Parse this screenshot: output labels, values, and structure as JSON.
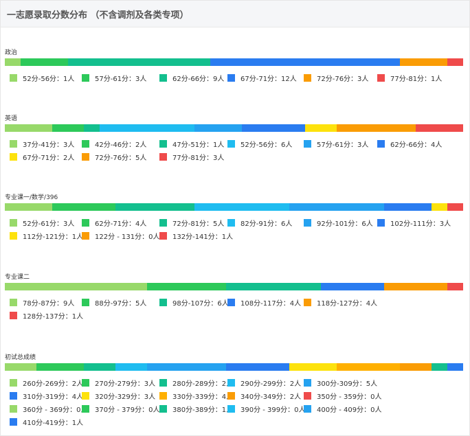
{
  "header": {
    "title": "一志愿录取分数分布 （不含调剂及各类专项）"
  },
  "palette": [
    "#98d96a",
    "#2dc95a",
    "#13bf8e",
    "#1fbcf0",
    "#25a2f0",
    "#2a7cf0",
    "#fde20d",
    "#ffb000",
    "#fa9c05",
    "#ef4b4b"
  ],
  "chart_data": [
    {
      "type": "stacked-bar",
      "title": "政治",
      "unit": "人",
      "categories": [
        "52分-56分",
        "57分-61分",
        "62分-66分",
        "67分-71分",
        "72分-76分",
        "77分-81分"
      ],
      "values": [
        1,
        3,
        9,
        12,
        3,
        1
      ],
      "colors": [
        "#98d96a",
        "#2dc95a",
        "#13bf8e",
        "#2a7cf0",
        "#fa9c05",
        "#ef4b4b"
      ],
      "legend_rows": [
        [
          0,
          1,
          2,
          3,
          4,
          5
        ]
      ]
    },
    {
      "type": "stacked-bar",
      "title": "英语",
      "unit": "人",
      "categories": [
        "37分-41分",
        "42分-46分",
        "47分-51分",
        "52分-56分",
        "57分-61分",
        "62分-66分",
        "67分-71分",
        "72分-76分",
        "77分-81分"
      ],
      "values": [
        3,
        2,
        1,
        6,
        3,
        4,
        2,
        5,
        3
      ],
      "colors": [
        "#98d96a",
        "#2dc95a",
        "#13bf8e",
        "#1fbcf0",
        "#25a2f0",
        "#2a7cf0",
        "#fde20d",
        "#fa9c05",
        "#ef4b4b"
      ],
      "legend_rows": [
        [
          0,
          1,
          2,
          3,
          4,
          5
        ],
        [
          6,
          7,
          8
        ]
      ]
    },
    {
      "type": "stacked-bar",
      "title": "专业课一/数学/396",
      "unit": "人",
      "categories": [
        "52分-61分",
        "62分-71分",
        "72分-81分",
        "82分-91分",
        "92分-101分",
        "102分-111分",
        "112分-121分",
        "122分 - 131分",
        "132分-141分"
      ],
      "values": [
        3,
        4,
        5,
        6,
        6,
        3,
        1,
        0,
        1
      ],
      "colors": [
        "#98d96a",
        "#2dc95a",
        "#13bf8e",
        "#1fbcf0",
        "#25a2f0",
        "#2a7cf0",
        "#fde20d",
        "#fa9c05",
        "#ef4b4b"
      ],
      "legend_rows": [
        [
          0,
          1,
          2,
          3,
          4,
          5
        ],
        [
          6,
          7,
          8
        ]
      ]
    },
    {
      "type": "stacked-bar",
      "title": "专业课二",
      "unit": "人",
      "categories": [
        "78分-87分",
        "88分-97分",
        "98分-107分",
        "108分-117分",
        "118分-127分",
        "128分-137分"
      ],
      "values": [
        9,
        5,
        6,
        4,
        4,
        1
      ],
      "colors": [
        "#98d96a",
        "#2dc95a",
        "#13bf8e",
        "#2a7cf0",
        "#fa9c05",
        "#ef4b4b"
      ],
      "legend_rows": [
        [
          0,
          1,
          2,
          3,
          4
        ],
        [
          5
        ]
      ]
    },
    {
      "type": "stacked-bar",
      "title": "初试总成绩",
      "unit": "人",
      "categories": [
        "260分-269分",
        "270分-279分",
        "280分-289分",
        "290分-299分",
        "300分-309分",
        "310分-319分",
        "320分-329分",
        "330分-339分",
        "340分-349分",
        "350分 - 359分",
        "360分 - 369分",
        "370分 - 379分",
        "380分-389分",
        "390分 - 399分",
        "400分 - 409分",
        "410分-419分"
      ],
      "values": [
        2,
        3,
        2,
        2,
        5,
        4,
        3,
        4,
        2,
        0,
        0,
        0,
        1,
        0,
        0,
        1
      ],
      "colors": [
        "#98d96a",
        "#2dc95a",
        "#13bf8e",
        "#1fbcf0",
        "#25a2f0",
        "#2a7cf0",
        "#fde20d",
        "#ffb000",
        "#fa9c05",
        "#ef4b4b",
        "#98d96a",
        "#2dc95a",
        "#13bf8e",
        "#1fbcf0",
        "#25a2f0",
        "#2a7cf0"
      ],
      "legend_rows": [
        [
          0,
          1,
          2,
          3,
          4
        ],
        [
          5,
          6,
          7,
          8,
          9
        ],
        [
          10,
          11,
          12,
          13,
          14
        ],
        [
          15
        ]
      ]
    }
  ]
}
